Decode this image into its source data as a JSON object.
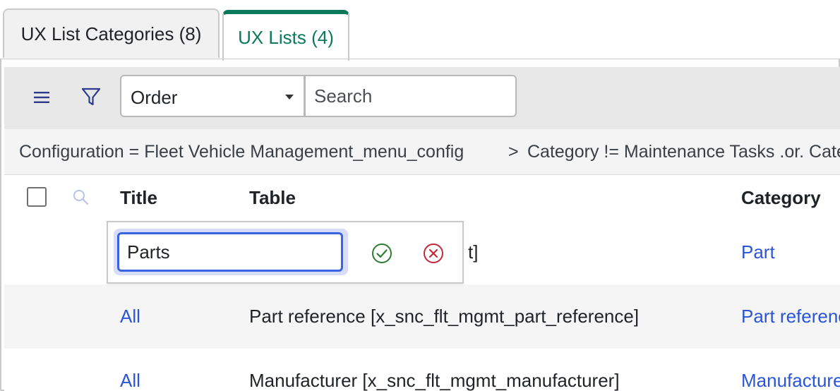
{
  "tabs": [
    {
      "label": "UX List Categories (8)"
    },
    {
      "label": "UX Lists (4)"
    }
  ],
  "toolbar": {
    "order_select_value": "Order",
    "search_placeholder": "Search"
  },
  "breadcrumb": {
    "crumb_1": "Configuration = Fleet Vehicle Management_menu_config",
    "separator": ">",
    "crumb_2": "Category != Maintenance Tasks .or. Category = ..."
  },
  "table": {
    "headers": {
      "title": "Title",
      "table": "Table",
      "category": "Category"
    },
    "rows": [
      {
        "title": "",
        "table": "t]",
        "category": "Part"
      },
      {
        "title": "All",
        "table": "Part reference [x_snc_flt_mgmt_part_reference]",
        "category": "Part reference"
      },
      {
        "title": "All",
        "table": "Manufacturer [x_snc_flt_mgmt_manufacturer]",
        "category": "Manufacturer"
      }
    ]
  },
  "editor": {
    "value": "Parts"
  },
  "colors": {
    "accent_green": "#0b7a5a",
    "link_blue": "#2b55d8",
    "focus_blue": "#3b63e0",
    "confirm_green": "#2e7d32",
    "cancel_red": "#c62839"
  },
  "icons": {
    "menu": "hamburger-icon",
    "filter": "funnel-icon",
    "column_search": "magnifier-icon",
    "confirm": "check-circle-icon",
    "cancel": "x-circle-icon"
  }
}
